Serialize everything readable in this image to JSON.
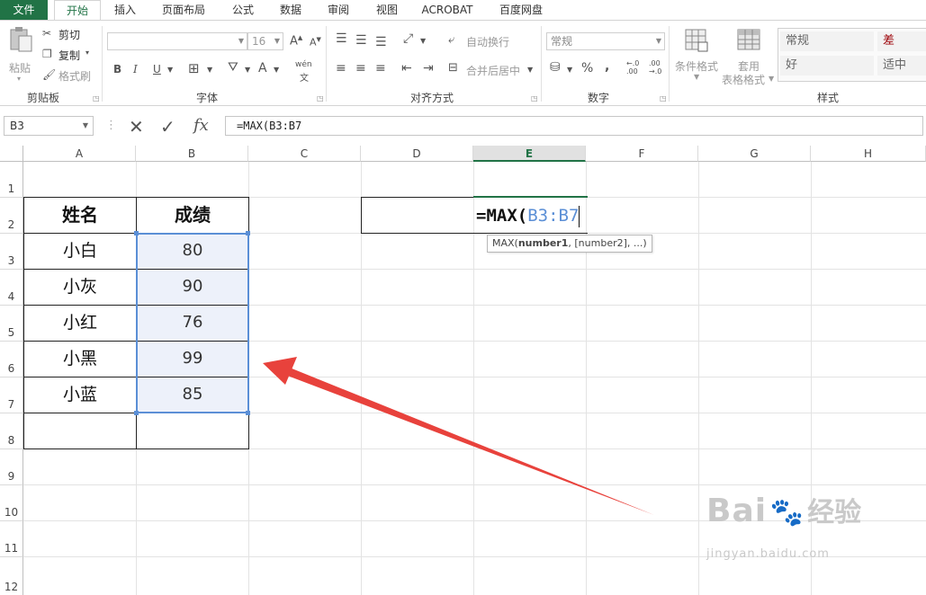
{
  "tabs": [
    "文件",
    "开始",
    "插入",
    "页面布局",
    "公式",
    "数据",
    "审阅",
    "视图",
    "ACROBAT",
    "百度网盘"
  ],
  "ribbon": {
    "clipboard": {
      "paste": "粘贴",
      "cut": "剪切",
      "copy": "复制",
      "format_painter": "格式刷",
      "label": "剪贴板"
    },
    "font": {
      "size": "16",
      "grow": "A",
      "shrink": "A",
      "bold": "B",
      "italic": "I",
      "underline": "U",
      "font_color": "A",
      "phonetic": "wén",
      "label": "字体"
    },
    "alignment": {
      "wrap_text": "自动换行",
      "merge_center": "合并后居中",
      "label": "对齐方式"
    },
    "number": {
      "format": "常规",
      "percent": "%",
      "comma": ",",
      "inc_decimal": "←.0\n.00",
      "dec_decimal": ".00\n→.0",
      "label": "数字"
    },
    "styles": {
      "conditional": "条件格式",
      "table_format_1": "套用",
      "table_format_2": "表格格式",
      "normal": "常规",
      "bad": "差",
      "good": "好",
      "neutral": "适中",
      "label": "样式"
    }
  },
  "formula_bar": {
    "name_box": "B3",
    "formula": "=MAX(B3:B7"
  },
  "columns": [
    "A",
    "B",
    "C",
    "D",
    "E",
    "F",
    "G",
    "H"
  ],
  "rows": [
    "1",
    "2",
    "3",
    "4",
    "5",
    "6",
    "7",
    "8",
    "9",
    "10",
    "11",
    "12"
  ],
  "table": {
    "headers": [
      "姓名",
      "成绩"
    ],
    "rows": [
      {
        "name": "小白",
        "score": "80"
      },
      {
        "name": "小灰",
        "score": "90"
      },
      {
        "name": "小红",
        "score": "76"
      },
      {
        "name": "小黑",
        "score": "99"
      },
      {
        "name": "小蓝",
        "score": "85"
      }
    ]
  },
  "edit_cell": {
    "prefix": "=MAX(",
    "ref": "B3:B7"
  },
  "tooltip": {
    "fn": "MAX(",
    "arg1": "number1",
    "rest": ", [number2], ...)"
  },
  "watermark": {
    "brand": "Bai",
    "brand2": "经验",
    "url": "jingyan.baidu.com"
  },
  "colors": {
    "accent": "#217346",
    "selection": "#5b8fd6",
    "arrow": "#e8423c"
  }
}
